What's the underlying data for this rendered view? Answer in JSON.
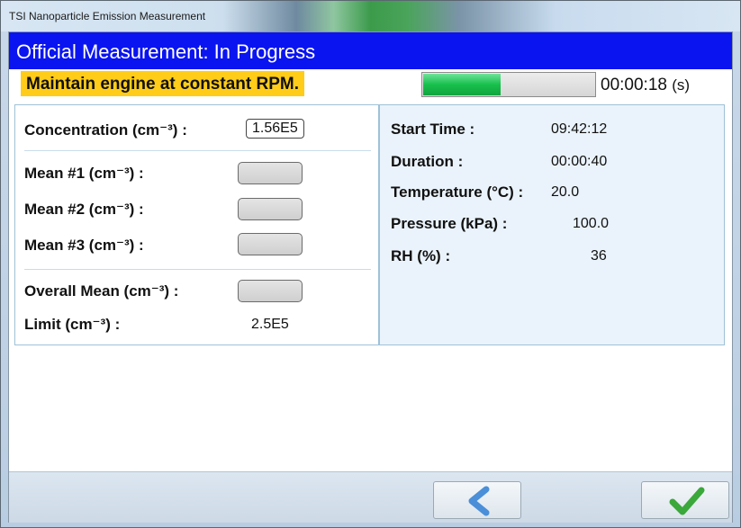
{
  "window": {
    "title": "TSI Nanoparticle Emission Measurement"
  },
  "header": {
    "status_title": "Official Measurement: In Progress"
  },
  "instruction": {
    "text": "Maintain engine at constant RPM."
  },
  "progress": {
    "fraction": 0.45,
    "elapsed": "00:00:18",
    "unit": "(s)"
  },
  "left_panel": {
    "concentration_label": "Concentration (cm⁻³) :",
    "concentration_value": "1.56E5",
    "mean1_label": "Mean #1 (cm⁻³) :",
    "mean2_label": "Mean #2 (cm⁻³) :",
    "mean3_label": "Mean #3 (cm⁻³) :",
    "overall_label": "Overall Mean (cm⁻³) :",
    "limit_label": "Limit (cm⁻³) :",
    "limit_value": "2.5E5"
  },
  "right_panel": {
    "start_time_label": "Start Time :",
    "start_time_value": "09:42:12",
    "duration_label": "Duration :",
    "duration_value": "00:00:40",
    "temperature_label": "Temperature (°C) :",
    "temperature_value": "20.0",
    "pressure_label": "Pressure (kPa) :",
    "pressure_value": "100.0",
    "rh_label": "RH (%) :",
    "rh_value": "36"
  },
  "footer": {
    "back_icon": "chevron-left-icon",
    "confirm_icon": "checkmark-icon",
    "accent_colors": {
      "back": "#4a8fd8",
      "confirm": "#3aa83a"
    }
  },
  "colors": {
    "header_band": "#0a14f0",
    "instruction_bg": "#ffcc19",
    "progress_fill": "#17c04c"
  }
}
